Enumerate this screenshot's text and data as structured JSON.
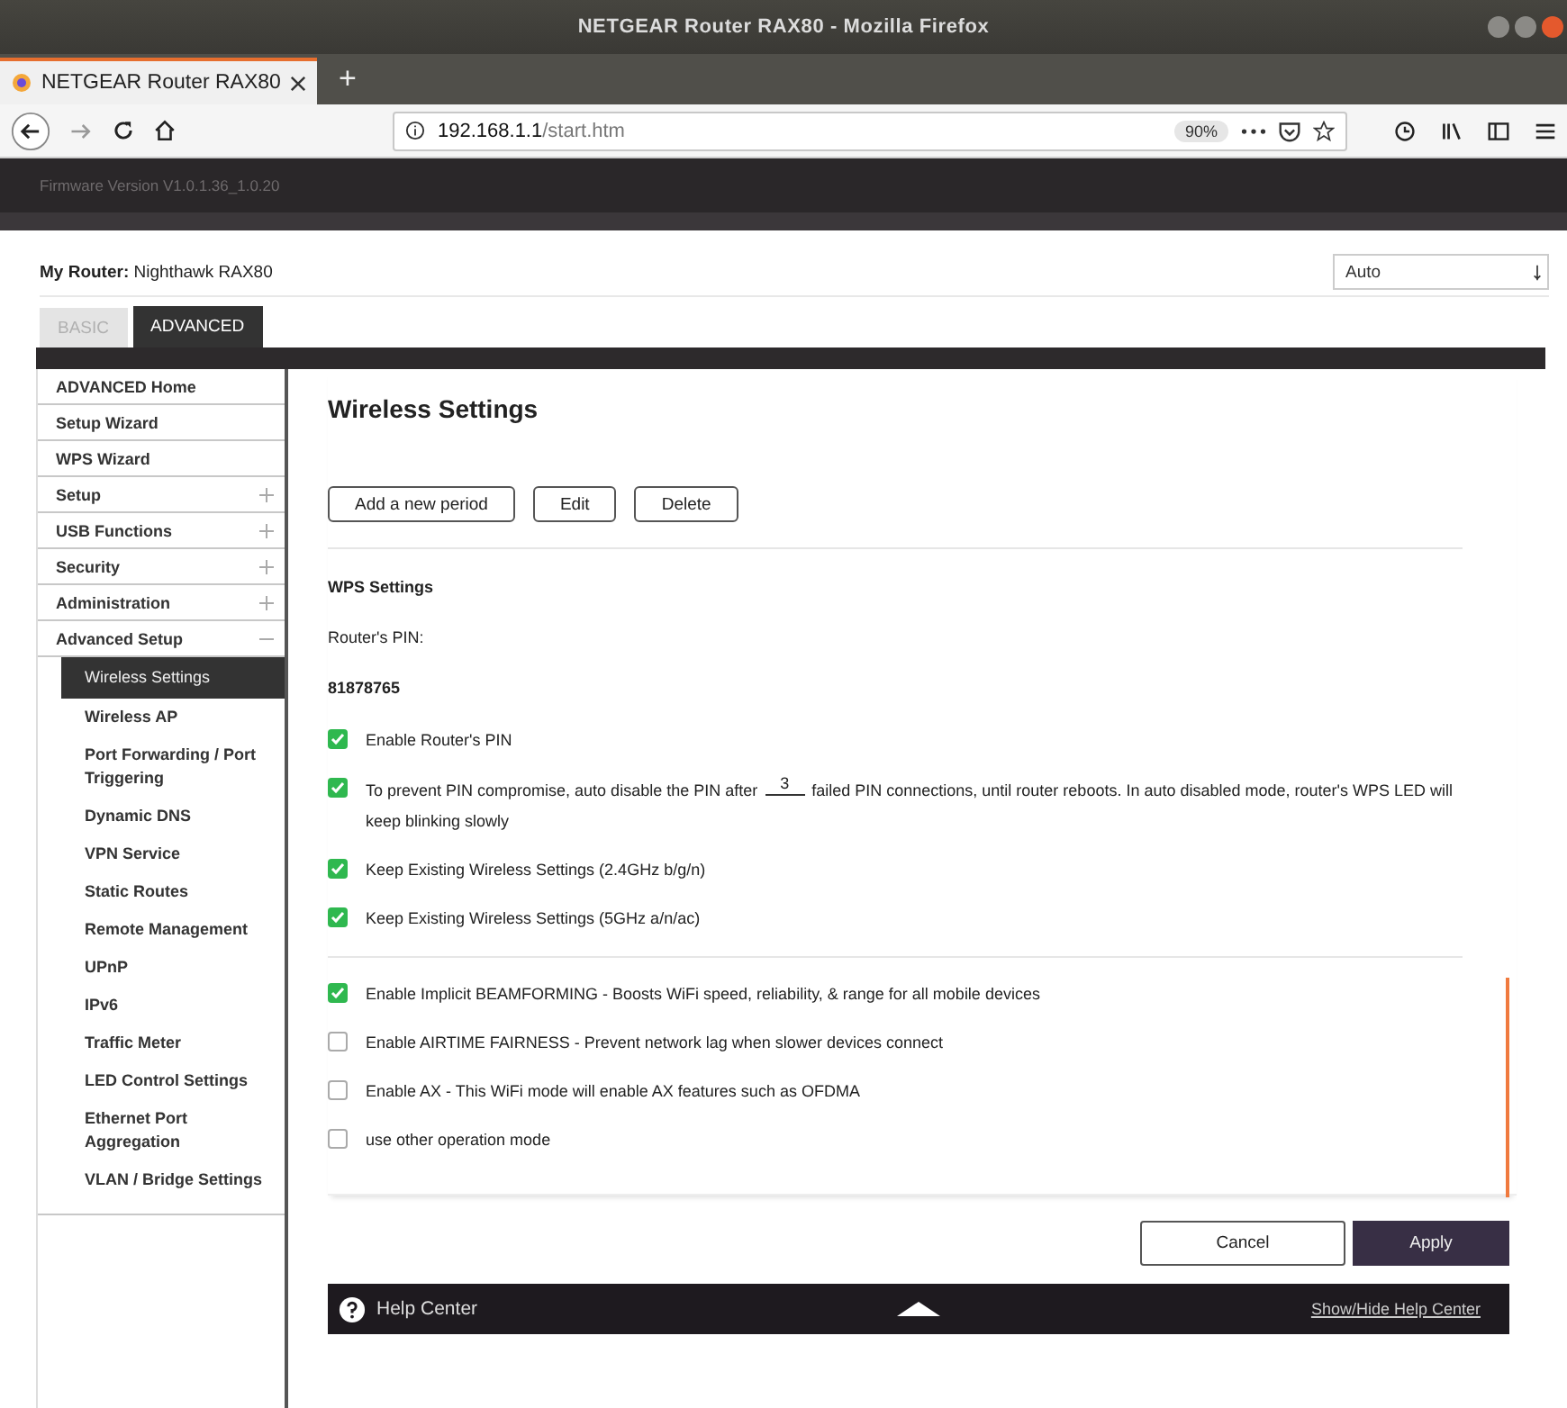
{
  "browser": {
    "window_title": "NETGEAR Router RAX80 - Mozilla Firefox",
    "tab_title": "NETGEAR Router RAX80",
    "new_tab": "+",
    "url_host": "192.168.1.1",
    "url_path": "/start.htm",
    "zoom": "90%"
  },
  "header": {
    "firmware": "Firmware Version V1.0.1.36_1.0.20"
  },
  "router": {
    "label": "My Router:",
    "name": "Nighthawk RAX80",
    "language": "Auto"
  },
  "tabs": [
    {
      "label": "BASIC",
      "selected": false
    },
    {
      "label": "ADVANCED",
      "selected": true
    }
  ],
  "sidebar": {
    "items": [
      {
        "label": "ADVANCED Home",
        "kind": "link"
      },
      {
        "label": "Setup Wizard",
        "kind": "link"
      },
      {
        "label": "WPS Wizard",
        "kind": "link"
      },
      {
        "label": "Setup",
        "kind": "group",
        "expanded": false
      },
      {
        "label": "USB Functions",
        "kind": "group",
        "expanded": false
      },
      {
        "label": "Security",
        "kind": "group",
        "expanded": false
      },
      {
        "label": "Administration",
        "kind": "group",
        "expanded": false
      },
      {
        "label": "Advanced Setup",
        "kind": "group",
        "expanded": true,
        "children": [
          {
            "label": "Wireless Settings",
            "selected": true
          },
          {
            "label": "Wireless AP",
            "selected": false
          },
          {
            "label": "Port Forwarding / Port Triggering",
            "selected": false
          },
          {
            "label": "Dynamic DNS",
            "selected": false
          },
          {
            "label": "VPN Service",
            "selected": false
          },
          {
            "label": "Static Routes",
            "selected": false
          },
          {
            "label": "Remote Management",
            "selected": false
          },
          {
            "label": "UPnP",
            "selected": false
          },
          {
            "label": "IPv6",
            "selected": false
          },
          {
            "label": "Traffic Meter",
            "selected": false
          },
          {
            "label": "LED Control Settings",
            "selected": false
          },
          {
            "label": "Ethernet Port Aggregation",
            "selected": false
          },
          {
            "label": "VLAN / Bridge Settings",
            "selected": false
          }
        ]
      }
    ]
  },
  "panel": {
    "title": "Wireless Settings",
    "buttons": [
      "Add a new period",
      "Edit",
      "Delete"
    ],
    "wps": {
      "heading": "WPS Settings",
      "pin_label": "Router's PIN:",
      "pin_value": "81878765",
      "options": [
        {
          "kind": "checkbox",
          "label": "Enable Router's PIN",
          "checked": true
        },
        {
          "kind": "inline-field",
          "label_before": "To prevent PIN compromise, auto disable the PIN after",
          "value": "3",
          "label_after": "failed PIN connections, until router reboots. In auto disabled mode, router's WPS LED will keep blinking slowly",
          "checked": true
        },
        {
          "kind": "checkbox",
          "label": "Keep Existing Wireless Settings (2.4GHz b/g/n)",
          "checked": true
        },
        {
          "kind": "checkbox",
          "label": "Keep Existing Wireless Settings (5GHz a/n/ac)",
          "checked": true
        }
      ]
    },
    "advanced_options": [
      {
        "label": "Enable Implicit BEAMFORMING - Boosts WiFi speed, reliability, & range for all mobile devices",
        "checked": true
      },
      {
        "label": "Enable AIRTIME FAIRNESS - Prevent network lag when slower devices connect",
        "checked": false
      },
      {
        "label": "Enable AX - This WiFi mode will enable AX features such as OFDMA",
        "checked": false
      },
      {
        "label": "use other operation mode",
        "checked": false
      }
    ]
  },
  "actions": [
    "Cancel",
    "Apply"
  ],
  "help_bar": {
    "title": "Help Center",
    "toggle": "Show/Hide Help Center"
  }
}
